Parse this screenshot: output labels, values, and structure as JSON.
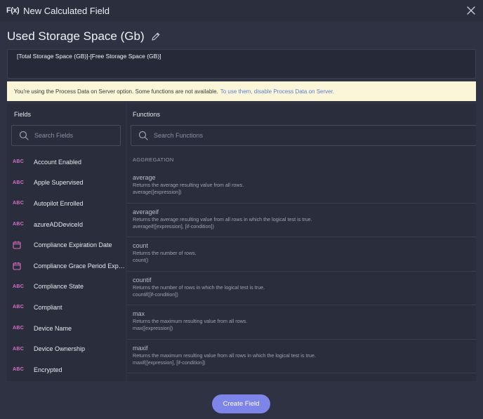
{
  "window": {
    "icon_text": "F(x)",
    "title": "New Calculated Field"
  },
  "field_name": "Used Storage Space (Gb)",
  "formula": "[Total Storage Space (GB)]-[Free Storage Space (GB)]",
  "warning": {
    "text": "You're using the Process Data on Server option. Some functions are not available.",
    "link": "To use them, disable Process Data on Server."
  },
  "fields_panel": {
    "header": "Fields",
    "search_placeholder": "Search Fields",
    "items": [
      {
        "type": "ABC",
        "label": "Account Enabled"
      },
      {
        "type": "ABC",
        "label": "Apple Supervised"
      },
      {
        "type": "ABC",
        "label": "Autopilot Enrolled"
      },
      {
        "type": "ABC",
        "label": "azureADDeviceId"
      },
      {
        "type": "date",
        "label": "Compliance Expiration Date"
      },
      {
        "type": "date",
        "label": "Compliance Grace Period Expir..."
      },
      {
        "type": "ABC",
        "label": "Compliance State"
      },
      {
        "type": "ABC",
        "label": "Compliant"
      },
      {
        "type": "ABC",
        "label": "Device Name"
      },
      {
        "type": "ABC",
        "label": "Device Ownership"
      },
      {
        "type": "ABC",
        "label": "Encrypted"
      }
    ]
  },
  "functions_panel": {
    "header": "Functions",
    "search_placeholder": "Search Functions",
    "category": "AGGREGATION",
    "items": [
      {
        "name": "average",
        "desc": "Returns the average resulting value from all rows.",
        "sig": "average([expression])"
      },
      {
        "name": "averageif",
        "desc": "Returns the average resulting value from all rows in which the logical test is true.",
        "sig": "averageif([expression], [if-condition])"
      },
      {
        "name": "count",
        "desc": "Returns the number of rows.",
        "sig": "count()"
      },
      {
        "name": "countif",
        "desc": "Returns the number of rows in which the logical test is true.",
        "sig": "countif([if-condition])"
      },
      {
        "name": "max",
        "desc": "Returns the maximum resulting value from all rows.",
        "sig": "max([expression])"
      },
      {
        "name": "maxif",
        "desc": "Returns the maximum resulting value from all rows in which the logical test is true.",
        "sig": "maxif([expression], [if-condition])"
      }
    ]
  },
  "footer": {
    "create_label": "Create Field"
  },
  "colors": {
    "accent": "#7d85e8",
    "abc_type": "#d96fc8",
    "warning_bg": "#fbf6d7",
    "link": "#5b7fd6"
  }
}
